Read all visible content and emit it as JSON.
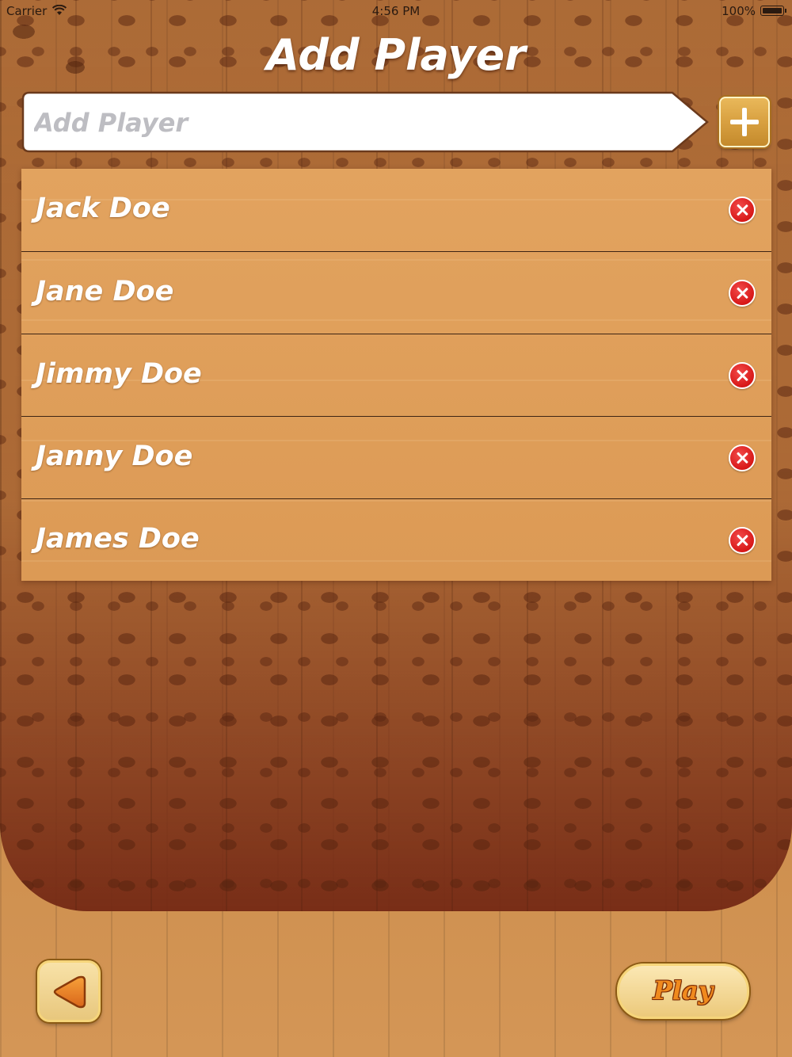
{
  "status_bar": {
    "carrier": "Carrier",
    "time": "4:56 PM",
    "battery": "100%"
  },
  "header": {
    "title": "Add Player"
  },
  "player_input": {
    "value": "",
    "placeholder": "Add Player",
    "add_icon": "plus-icon"
  },
  "players": [
    {
      "name": "Jack Doe",
      "remove_icon": "close-icon"
    },
    {
      "name": "Jane Doe",
      "remove_icon": "close-icon"
    },
    {
      "name": "Jimmy Doe",
      "remove_icon": "close-icon"
    },
    {
      "name": "Janny Doe",
      "remove_icon": "close-icon"
    },
    {
      "name": "James Doe",
      "remove_icon": "close-icon"
    }
  ],
  "footer": {
    "back_icon": "back-arrow-icon",
    "play_label": "Play"
  },
  "colors": {
    "accent_gold": "#d8a040",
    "remove_red": "#d81818",
    "list_wood": "#dc9a55",
    "play_text": "#f08a1e"
  }
}
